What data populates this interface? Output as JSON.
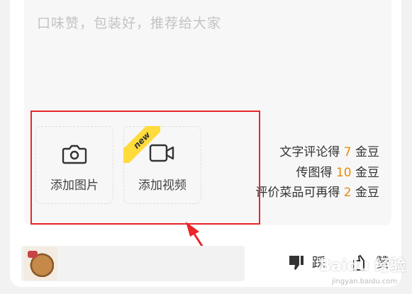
{
  "review": {
    "placeholder": "口味赞，包装好，推荐给大家"
  },
  "upload": {
    "add_photo_label": "添加图片",
    "add_video_label": "添加视频",
    "video_badge": "new"
  },
  "rewards": {
    "line1_prefix": "文字评论得 ",
    "line1_num": "7",
    "line1_suffix": " 金豆",
    "line2_prefix": "传图得 ",
    "line2_num": "10",
    "line2_suffix": " 金豆",
    "line3_prefix": "评价菜品可再得 ",
    "line3_num": "2",
    "line3_suffix": " 金豆"
  },
  "footer": {
    "dislike_label": "踩",
    "like_label": "赞"
  },
  "watermark": {
    "text": "Baidu 经验",
    "sub": "jingyan.baidu.com"
  },
  "colors": {
    "accent": "#e88a0b",
    "highlight": "#e8262b",
    "badge": "#ffdb3c"
  }
}
